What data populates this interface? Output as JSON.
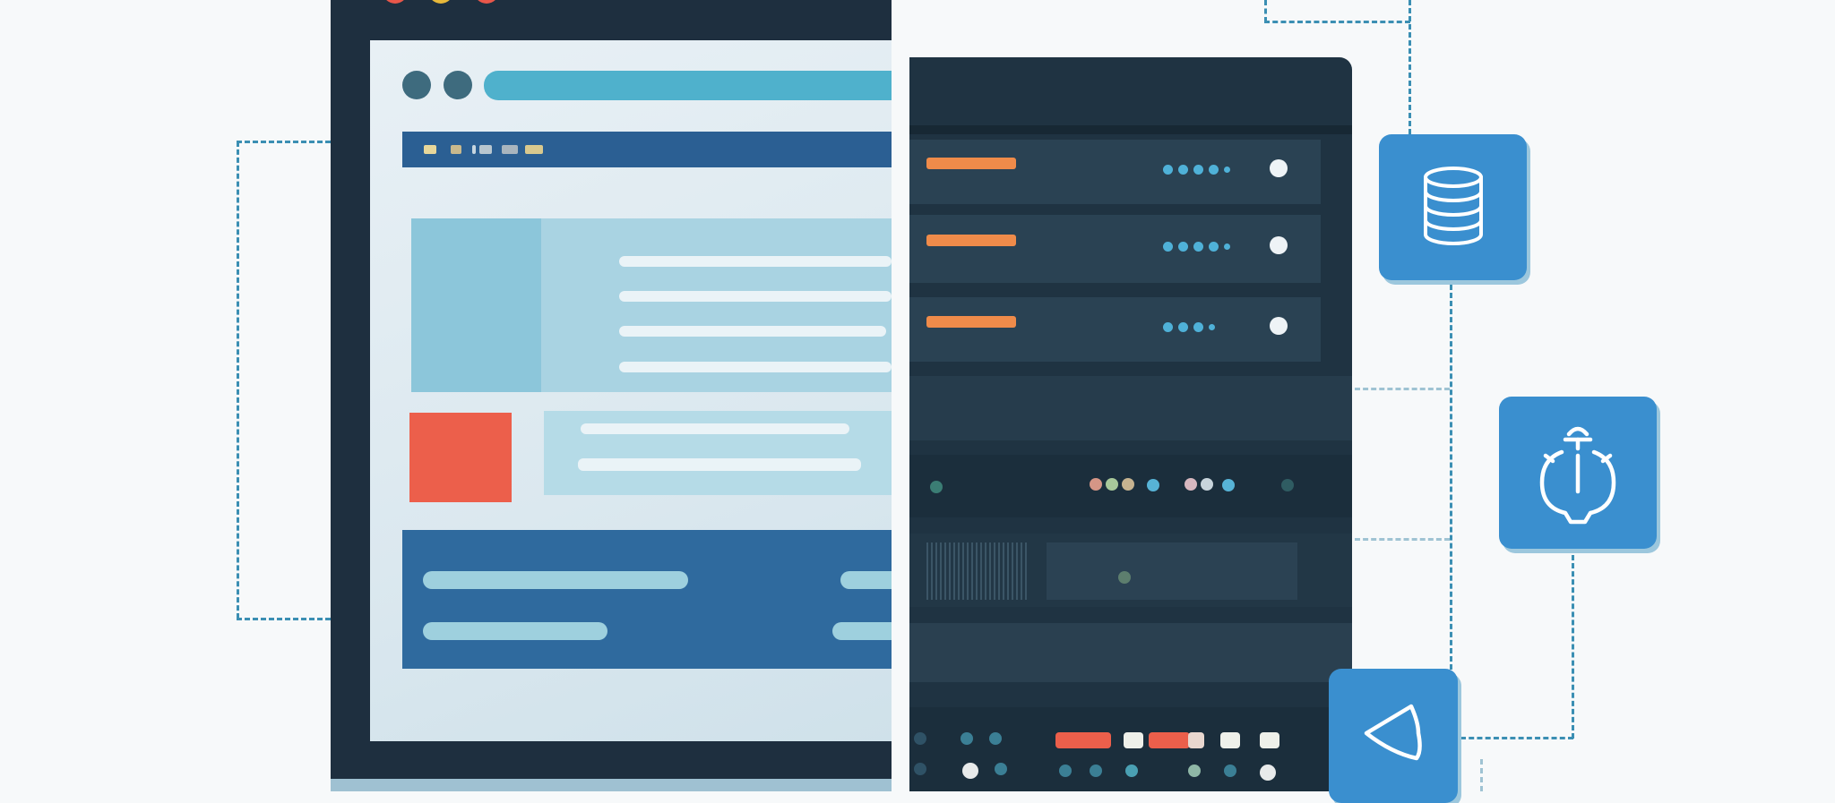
{
  "colors": {
    "background": "#f7f9fa",
    "browser_frame": "#1e2f3f",
    "address_bar": "#4fb1cc",
    "header_bar": "#2b5f93",
    "accent_red": "#ec5f4b",
    "rack": "#1f3342",
    "tile_blue": "#3a8fcf",
    "led_orange": "#ef8b4a",
    "connector": "#3b8fb3"
  },
  "browser": {
    "traffic_lights": [
      "close-dot",
      "minimize-dot",
      "maximize-dot"
    ]
  },
  "tiles": [
    {
      "icon": "database-icon"
    },
    {
      "icon": "settings-icon"
    },
    {
      "icon": "send-icon"
    }
  ]
}
